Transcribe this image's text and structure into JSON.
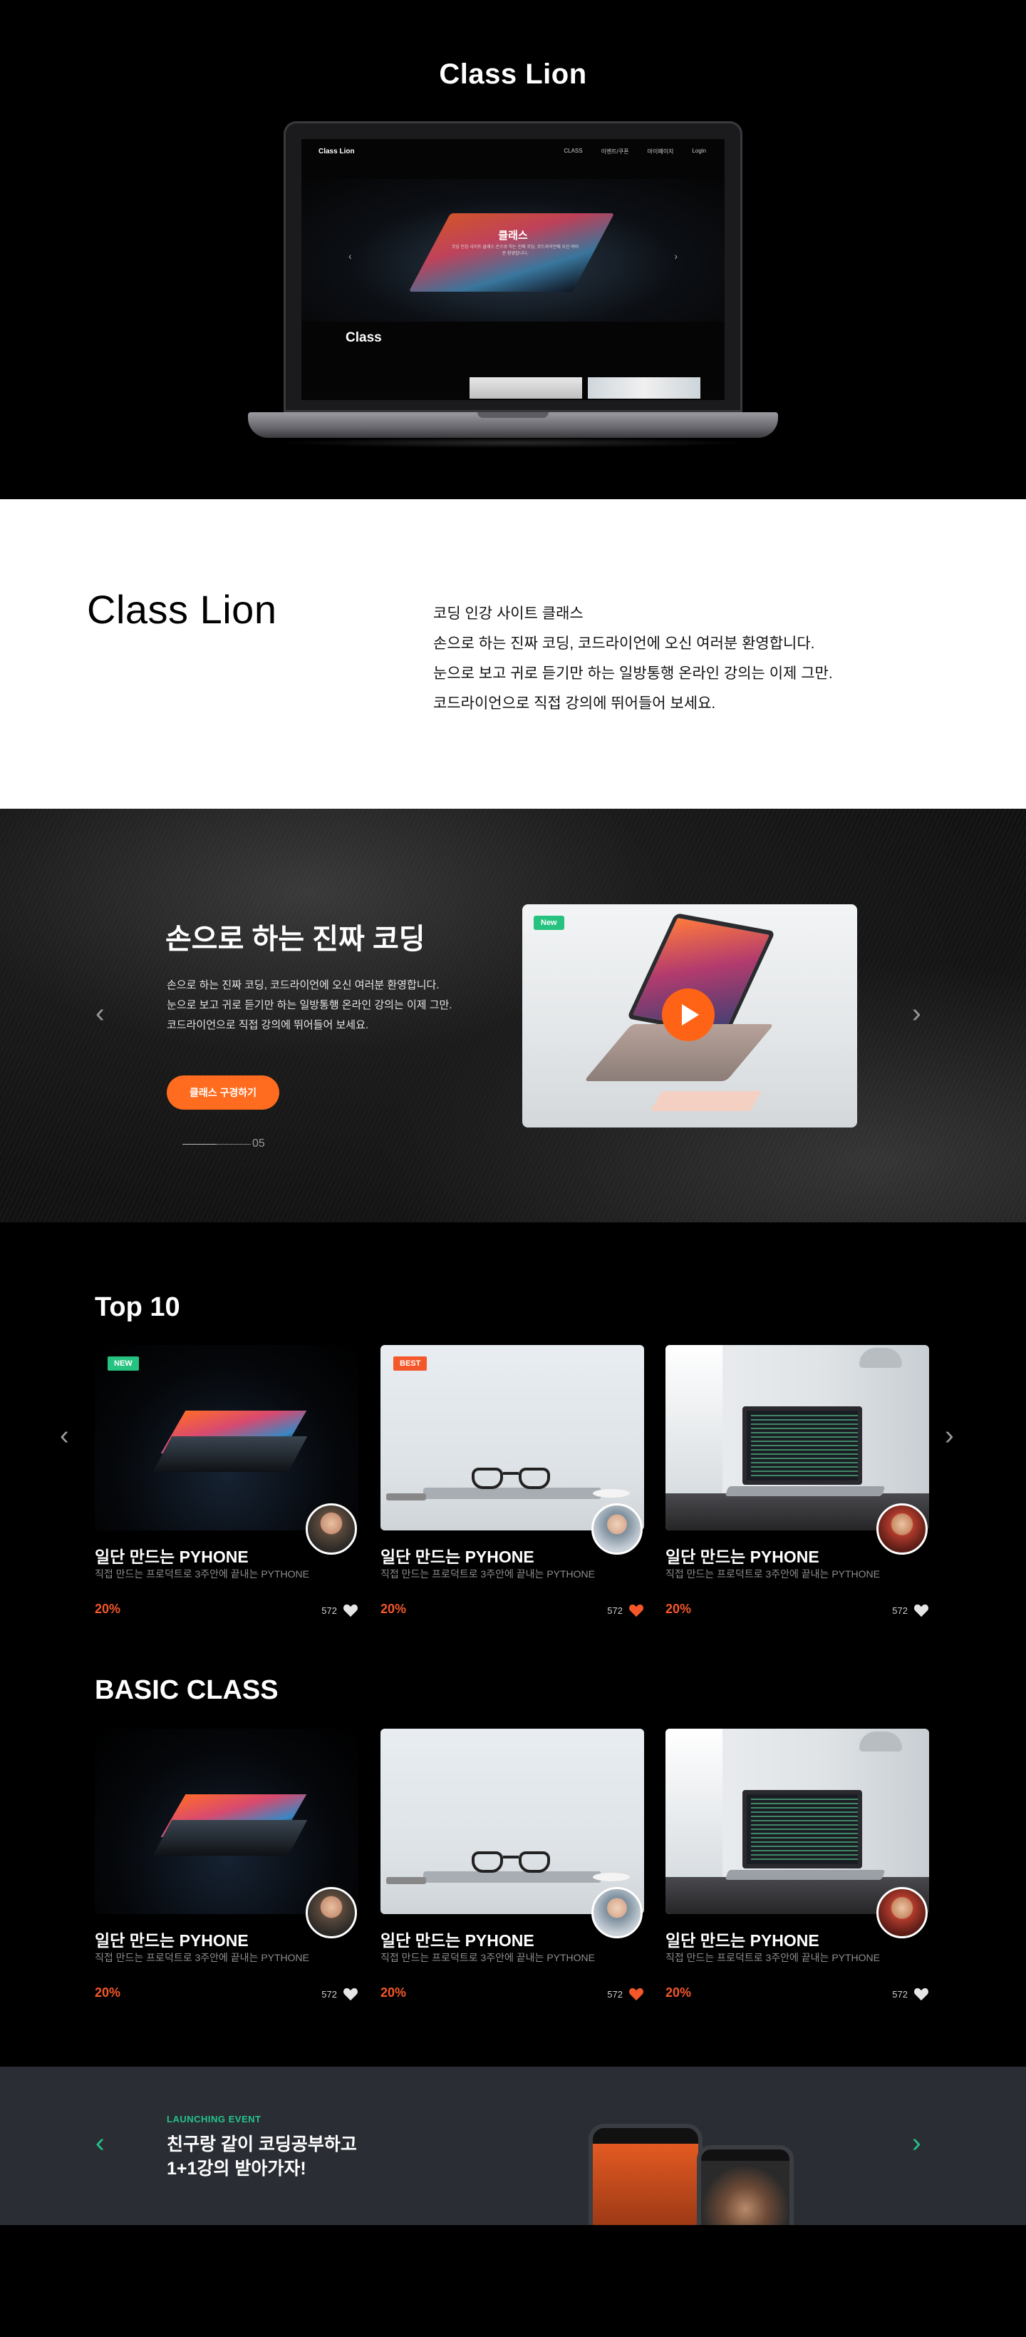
{
  "hero": {
    "title": "Class Lion",
    "mockup": {
      "logo": "Class Lion",
      "menu": [
        "CLASS",
        "이벤트/쿠폰",
        "마이페이지",
        "Login"
      ],
      "banner_title": "클래스",
      "banner_text": "코딩 인강 사이트 클래스 손으로 하는 진짜 코딩, 코드라이언에 오신 여러분 환영합니다.",
      "section_label": "Class"
    }
  },
  "intro": {
    "title": "Class Lion",
    "lines": [
      "코딩 인강 사이트 클래스",
      "손으로 하는 진짜 코딩, 코드라이언에 오신 여러분 환영합니다.",
      "눈으로 보고 귀로 듣기만 하는 일방통행 온라인 강의는 이제 그만.",
      "코드라이언으로 직접 강의에 뛰어들어 보세요."
    ]
  },
  "slider": {
    "title": "손으로 하는 진짜 코딩",
    "lines": [
      "손으로 하는 진짜 코딩, 코드라이언에 오신 여러분 환영합니다.",
      "눈으로 보고 귀로 듣기만 하는 일방통행 온라인 강의는 이제 그만.",
      "코드라이언으로 직접 강의에 뛰어들어 보세요."
    ],
    "button": "클래스 구경하기",
    "counter": "05",
    "card_badge": "New",
    "prev_arrow": "‹",
    "next_arrow": "›"
  },
  "top10": {
    "title": "Top 10",
    "cards": [
      {
        "badge": "NEW",
        "title": "일단 만드는 PYHONE",
        "subtitle": "직접 만드는 프로덕트로 3주안에 끝내는 PYTHONE",
        "discount": "20%",
        "likes": "572",
        "liked": false
      },
      {
        "badge": "BEST",
        "title": "일단 만드는 PYHONE",
        "subtitle": "직접 만드는 프로덕트로 3주안에 끝내는 PYTHONE",
        "discount": "20%",
        "likes": "572",
        "liked": true
      },
      {
        "badge": "",
        "title": "일단 만드는 PYHONE",
        "subtitle": "직접 만드는 프로덕트로 3주안에 끝내는 PYTHONE",
        "discount": "20%",
        "likes": "572",
        "liked": false
      }
    ]
  },
  "basic": {
    "title": "BASIC CLASS",
    "cards": [
      {
        "title": "일단 만드는 PYHONE",
        "subtitle": "직접 만드는 프로덕트로 3주안에 끝내는 PYTHONE",
        "discount": "20%",
        "likes": "572",
        "liked": false
      },
      {
        "title": "일단 만드는 PYHONE",
        "subtitle": "직접 만드는 프로덕트로 3주안에 끝내는 PYTHONE",
        "discount": "20%",
        "likes": "572",
        "liked": true
      },
      {
        "title": "일단 만드는 PYHONE",
        "subtitle": "직접 만드는 프로덕트로 3주안에 끝내는 PYTHONE",
        "discount": "20%",
        "likes": "572",
        "liked": false
      }
    ]
  },
  "event": {
    "tag": "LAUNCHING EVENT",
    "title_line1": "친구랑 같이 코딩공부하고",
    "title_line2": "1+1강의 받아가자!"
  },
  "colors": {
    "accent_orange": "#ff6c1f",
    "accent_green": "#26c27f",
    "heart_liked": "#f4572a",
    "heart_default": "#e6e6e6"
  },
  "icons": {
    "chevron_left": "chevron-left-icon",
    "chevron_right": "chevron-right-icon",
    "heart": "heart-icon",
    "play": "play-icon"
  }
}
